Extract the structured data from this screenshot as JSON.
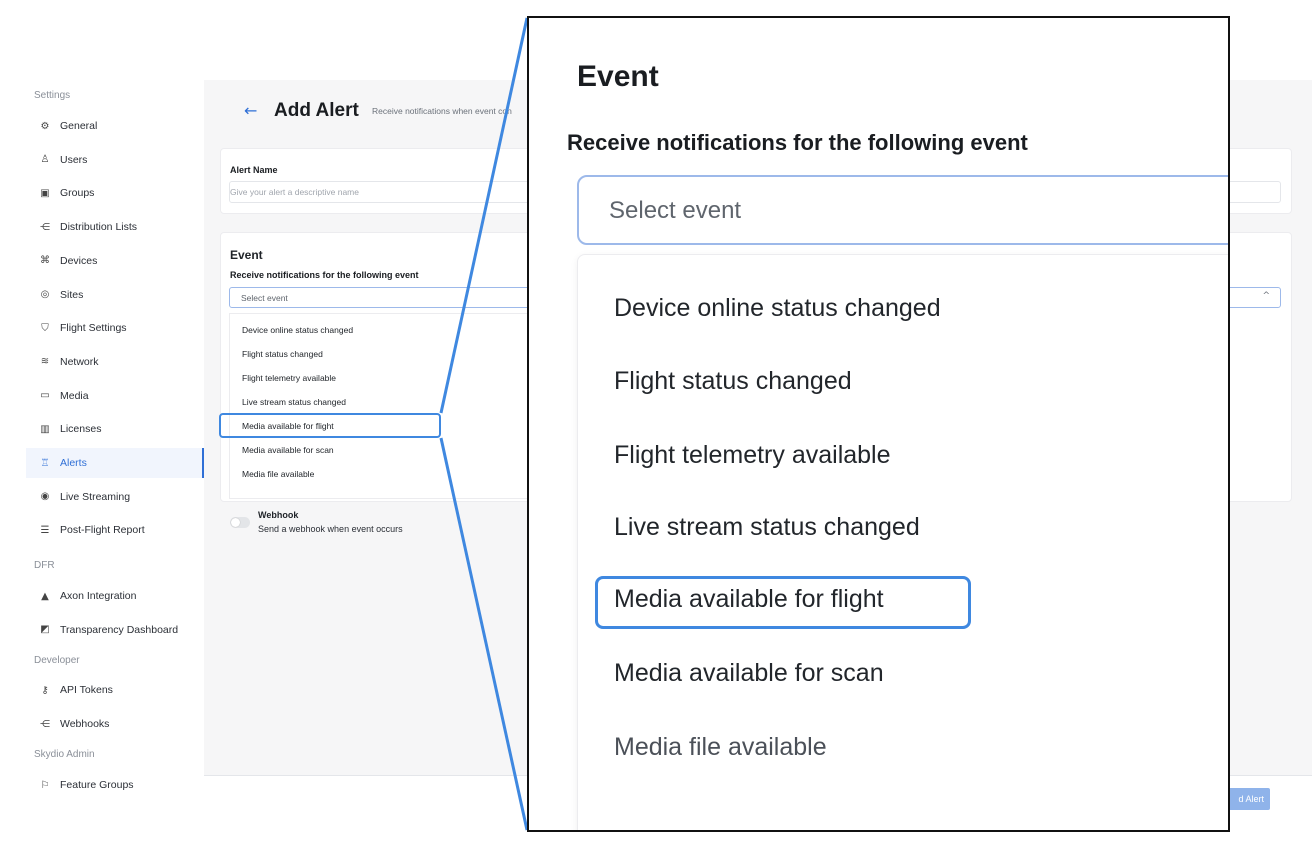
{
  "sidebar": {
    "sections": [
      {
        "title": "Settings",
        "items": [
          {
            "label": "General",
            "icon": "gear-icon",
            "glyph": "⚙"
          },
          {
            "label": "Users",
            "icon": "users-icon",
            "glyph": "♙"
          },
          {
            "label": "Groups",
            "icon": "groups-icon",
            "glyph": "▣"
          },
          {
            "label": "Distribution Lists",
            "icon": "distribution-icon",
            "glyph": "⋲"
          },
          {
            "label": "Devices",
            "icon": "drone-icon",
            "glyph": "⌘"
          },
          {
            "label": "Sites",
            "icon": "location-icon",
            "glyph": "◎"
          },
          {
            "label": "Flight Settings",
            "icon": "shield-icon",
            "glyph": "⛉"
          },
          {
            "label": "Network",
            "icon": "wifi-icon",
            "glyph": "≋"
          },
          {
            "label": "Media",
            "icon": "image-icon",
            "glyph": "▭"
          },
          {
            "label": "Licenses",
            "icon": "barcode-icon",
            "glyph": "▥"
          },
          {
            "label": "Alerts",
            "icon": "alarm-icon",
            "glyph": "♖",
            "active": true
          },
          {
            "label": "Live Streaming",
            "icon": "broadcast-icon",
            "glyph": "◉"
          },
          {
            "label": "Post-Flight Report",
            "icon": "checklist-icon",
            "glyph": "☰"
          }
        ]
      },
      {
        "title": "DFR",
        "items": [
          {
            "label": "Axon Integration",
            "icon": "axon-icon",
            "glyph": "▲"
          },
          {
            "label": "Transparency Dashboard",
            "icon": "dashboard-icon",
            "glyph": "◩"
          }
        ]
      },
      {
        "title": "Developer",
        "items": [
          {
            "label": "API Tokens",
            "icon": "key-icon",
            "glyph": "⚷"
          },
          {
            "label": "Webhooks",
            "icon": "webhook-icon",
            "glyph": "⋲"
          }
        ]
      },
      {
        "title": "Skydio Admin",
        "items": [
          {
            "label": "Feature Groups",
            "icon": "flag-icon",
            "glyph": "⚐"
          }
        ]
      }
    ]
  },
  "header": {
    "back_glyph": "←",
    "title": "Add Alert",
    "subtitle": "Receive notifications when event con"
  },
  "alert_name": {
    "label": "Alert Name",
    "placeholder": "Give your alert a descriptive name"
  },
  "event": {
    "title": "Event",
    "subtitle": "Receive notifications for the following event",
    "select_placeholder": "Select event",
    "chevron": "^",
    "options": [
      "Device online status changed",
      "Flight status changed",
      "Flight telemetry available",
      "Live stream status changed",
      "Media available for flight",
      "Media available for scan",
      "Media file available"
    ],
    "highlighted": "Media available for flight"
  },
  "webhook": {
    "title": "Webhook",
    "description": "Send a webhook when event occurs",
    "enabled": false
  },
  "footer": {
    "button_label": "d Alert"
  },
  "colors": {
    "accent": "#2f6fd6",
    "highlight": "#3f88e0"
  }
}
